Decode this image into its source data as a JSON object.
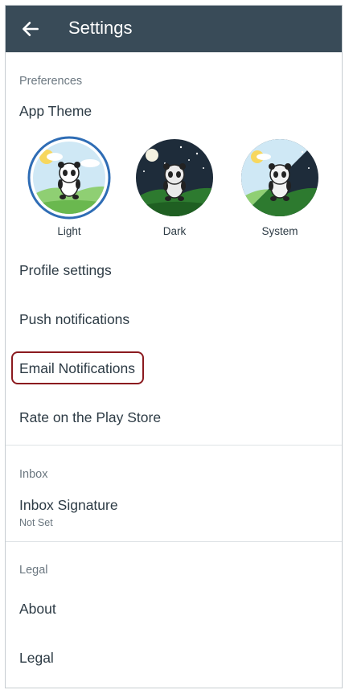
{
  "appbar": {
    "title": "Settings",
    "back_icon": "arrow-left-icon"
  },
  "preferences": {
    "section_label": "Preferences",
    "app_theme_label": "App Theme",
    "themes": [
      {
        "label": "Light",
        "selected": true
      },
      {
        "label": "Dark",
        "selected": false
      },
      {
        "label": "System",
        "selected": false
      }
    ],
    "items": [
      {
        "label": "Profile settings"
      },
      {
        "label": "Push notifications"
      },
      {
        "label": "Email Notifications",
        "highlighted": true
      },
      {
        "label": "Rate on the Play Store"
      }
    ]
  },
  "inbox": {
    "section_label": "Inbox",
    "signature_label": "Inbox Signature",
    "signature_value": "Not Set"
  },
  "legal": {
    "section_label": "Legal",
    "items": [
      {
        "label": "About"
      },
      {
        "label": "Legal"
      }
    ]
  },
  "colors": {
    "appbar": "#394b58",
    "highlight": "#8b1a1f",
    "selected_ring": "#2f6db5"
  }
}
